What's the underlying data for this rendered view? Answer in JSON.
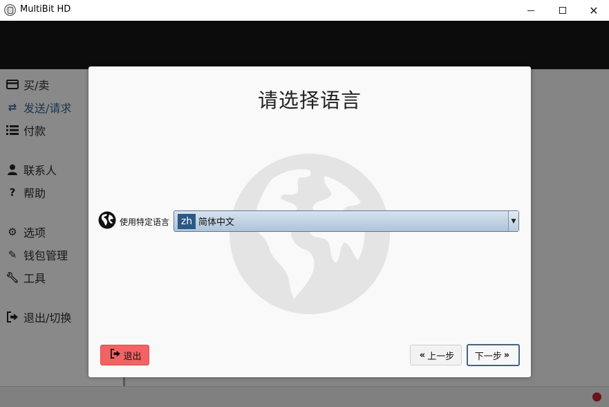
{
  "window": {
    "title": "MultiBit HD",
    "minimize_icon": "minimize-icon",
    "maximize_icon": "maximize-icon",
    "close_icon": "close-icon"
  },
  "sidebar": {
    "items": [
      {
        "label": "买/卖",
        "icon": "credit-card-icon"
      },
      {
        "label": "发送/请求",
        "icon": "exchange-icon",
        "active": true
      },
      {
        "label": "付款",
        "icon": "list-icon"
      },
      {
        "label": "联系人",
        "icon": "user-icon"
      },
      {
        "label": "帮助",
        "icon": "question-icon"
      },
      {
        "label": "选项",
        "icon": "gears-icon"
      },
      {
        "label": "钱包管理",
        "icon": "edit-icon"
      },
      {
        "label": "工具",
        "icon": "wrench-icon"
      },
      {
        "label": "退出/切换",
        "icon": "sign-out-icon"
      }
    ]
  },
  "modal": {
    "title": "请选择语言",
    "language_label": "使用特定语言",
    "language_select": {
      "code": "zh",
      "name": "简体中文"
    },
    "exit_button": "退出",
    "previous_button": "上一步",
    "next_button": "下一步"
  },
  "colors": {
    "header": "#161616",
    "active_nav": "#2f5d8c",
    "exit_button": "#f26363",
    "select_code_bg": "#2b5885",
    "status_dot": "#b52525"
  }
}
